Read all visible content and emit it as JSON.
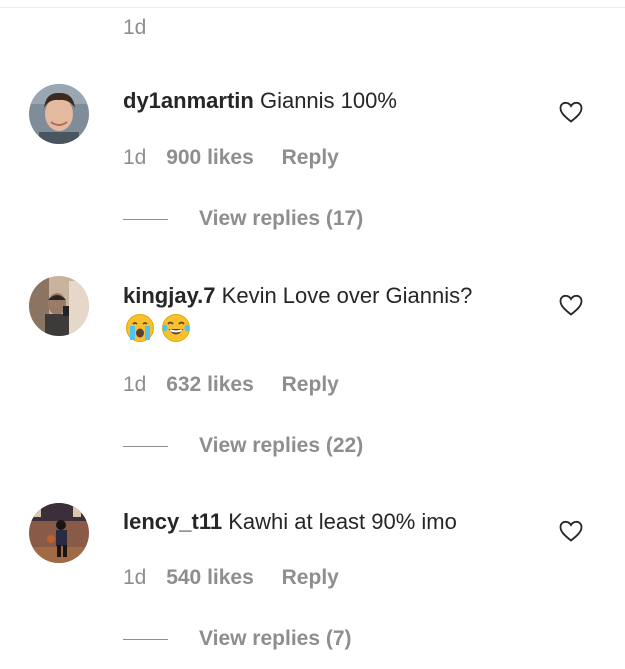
{
  "top": {
    "time": "1d"
  },
  "comments": [
    {
      "username": "dy1anmartin",
      "text": "Giannis 100%",
      "emoji": [],
      "time": "1d",
      "likes": "900 likes",
      "reply_label": "Reply",
      "view_replies": "View replies (17)",
      "avatar_colors": {
        "bg": "#6b7a8a",
        "skin": "#e3b9a0",
        "hair": "#3b2a20"
      }
    },
    {
      "username": "kingjay.7",
      "text": "Kevin Love over Giannis?",
      "emoji": [
        "crying-face",
        "tears-of-joy-face"
      ],
      "time": "1d",
      "likes": "632 likes",
      "reply_label": "Reply",
      "view_replies": "View replies (22)",
      "avatar_colors": {
        "bg": "#b9a48f",
        "skin": "#9a7b68",
        "hair": "#2d2522"
      }
    },
    {
      "username": "lency_t11",
      "text": "Kawhi at least 90% imo",
      "emoji": [],
      "time": "1d",
      "likes": "540 likes",
      "reply_label": "Reply",
      "view_replies": "View replies (7)",
      "avatar_colors": {
        "bg": "#7a4a3a",
        "skin": "#3a2a22",
        "hair": "#1c1412"
      }
    }
  ],
  "colors": {
    "primary_text": "#262626",
    "secondary_text": "#8e8e8e",
    "emoji_yellow": "#fbc02d",
    "tear_blue": "#4fc3f7"
  }
}
